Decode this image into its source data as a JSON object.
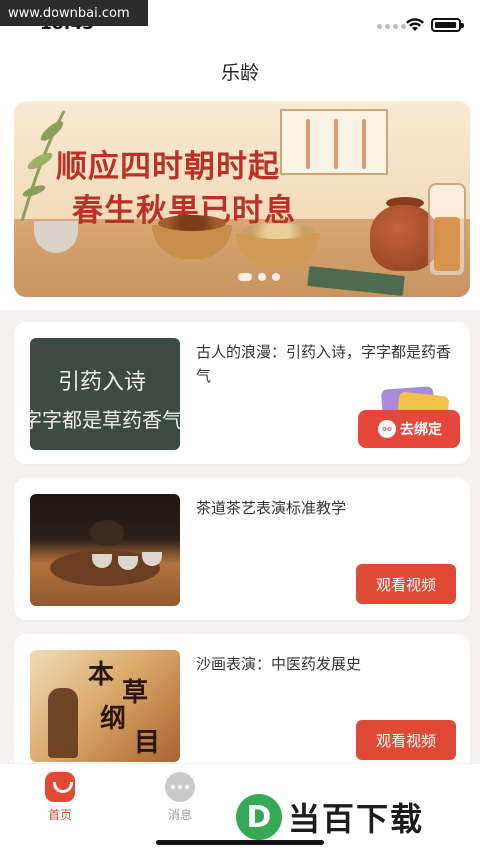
{
  "watermark": "www.downbai.com",
  "status": {
    "time": "18:43"
  },
  "header": {
    "title": "乐龄"
  },
  "banner": {
    "line1": "顺应四时朝时起",
    "line2": "春生秋果已时息",
    "slides": 3,
    "active_slide": 0
  },
  "cards": [
    {
      "title": "古人的浪漫：引药入诗，字字都是药香气",
      "thumb_line1": "引药入诗",
      "thumb_line2": "字字都是草药香气",
      "button": ""
    },
    {
      "title": "茶道茶艺表演标准教学",
      "button": "观看视频"
    },
    {
      "title": "沙画表演：中医药发展史",
      "thumb_text": [
        "本",
        "草",
        "纲",
        "目"
      ],
      "button": "观看视频"
    }
  ],
  "bind_badge": {
    "label": "去绑定"
  },
  "tabbar": {
    "items": [
      {
        "label": "首页",
        "icon": "home-icon",
        "active": true
      },
      {
        "label": "消息",
        "icon": "message-icon",
        "active": false
      }
    ],
    "accent": "#e04a35"
  },
  "brand_overlay": {
    "mark": "D",
    "text": "当百下载"
  },
  "colors": {
    "accent": "#e04a35",
    "banner_text": "#b8322a"
  }
}
